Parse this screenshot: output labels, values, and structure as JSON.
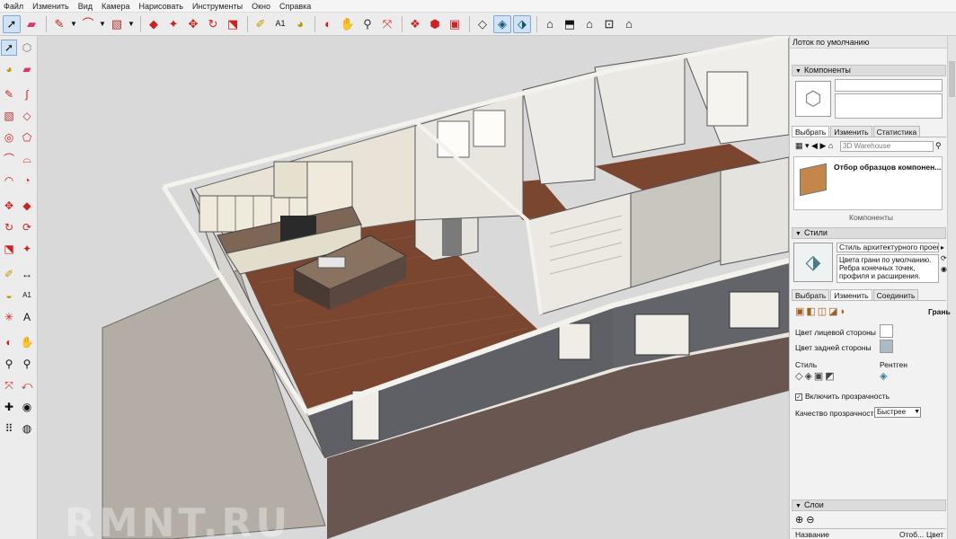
{
  "menu": [
    "Файл",
    "Изменить",
    "Вид",
    "Камера",
    "Нарисовать",
    "Инструменты",
    "Окно",
    "Справка"
  ],
  "toolbar_icons": [
    "select-icon",
    "eraser-icon",
    "pencil-icon",
    "chevron-down-icon",
    "arc-icon",
    "chevron-down-icon",
    "rectangle-icon",
    "chevron-down-icon",
    "push-pull-icon",
    "offset-icon",
    "move-icon",
    "rotate-icon",
    "scale-icon",
    "tape-measure-icon",
    "text-icon",
    "paint-bucket-icon",
    "orbit-icon",
    "pan-icon",
    "zoom-icon",
    "zoom-extents-icon",
    "3d-warehouse-icon",
    "share-model-icon",
    "extension-warehouse-icon",
    "x-ray-icon",
    "back-edges-icon",
    "wireframe-icon",
    "iso-view-icon",
    "top-view-icon",
    "front-view-icon",
    "right-view-icon",
    "back-view-icon"
  ],
  "watermark": "RMNT.RU",
  "tray": {
    "title": "Лоток по умолчанию",
    "components": {
      "header": "Компоненты",
      "tabs": [
        "Выбрать",
        "Изменить",
        "Статистика"
      ],
      "search_placeholder": "3D Warehouse",
      "result_title": "Отбор образцов компонен...",
      "footer": "Компоненты"
    },
    "styles": {
      "header": "Стили",
      "style_name": "Стиль архитектурного проект",
      "style_description": "Цвета грани по умолчанию. Ребра конечных точек, профиля и расширения.",
      "tabs": [
        "Выбрать",
        "Изменить",
        "Соединить"
      ],
      "face_settings_label": "Грань",
      "front_color_label": "Цвет лицевой стороны",
      "back_color_label": "Цвет задней стороны",
      "style_label": "Стиль",
      "xray_label": "Рентген",
      "transparency_label": "Включить прозрачность",
      "transparency_enabled": true,
      "quality_label": "Качество прозрачности:",
      "quality_value": "Быстрее",
      "front_color": "#ffffff",
      "back_color": "#a9bcc6"
    },
    "layers": {
      "header": "Слои",
      "col_name": "Название",
      "col_visible": "Отоб...",
      "col_color": "Цвет"
    }
  }
}
